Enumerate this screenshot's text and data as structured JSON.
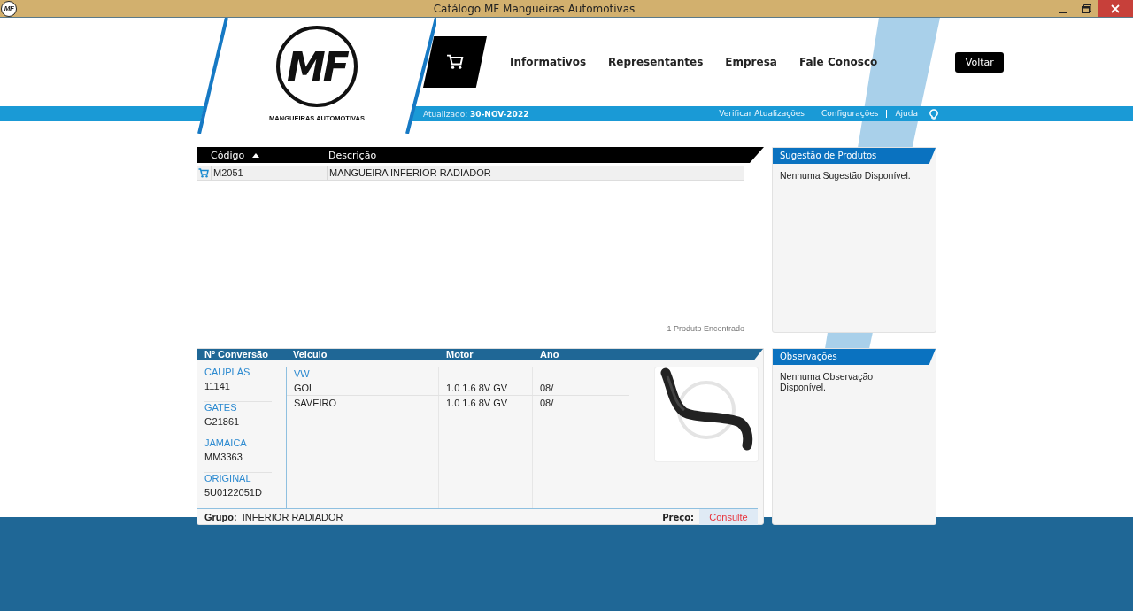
{
  "window": {
    "title": "Catálogo MF Mangueiras Automotivas",
    "icon_label": "MF"
  },
  "header": {
    "logo": {
      "mark": "MF",
      "tagline": "MANGUEIRAS AUTOMOTIVAS"
    },
    "nav": [
      "Informativos",
      "Representantes",
      "Empresa",
      "Fale Conosco"
    ],
    "back_button": "Voltar"
  },
  "info_bar": {
    "updated_label": "Atualizado:",
    "updated_date": "30-NOV-2022",
    "links": [
      "Verificar Atualizações",
      "Configurações",
      "Ajuda"
    ]
  },
  "products": {
    "columns": [
      {
        "label": "Código",
        "sorted_ascending": true
      },
      {
        "label": "Descrição"
      }
    ],
    "rows": [
      {
        "code": "M2051",
        "description": "MANGUEIRA INFERIOR RADIADOR"
      }
    ],
    "count": "1 Produto Encontrado"
  },
  "suggestions": {
    "title": "Sugestão de Produtos",
    "text": "Nenhuma Sugestão Disponível."
  },
  "details": {
    "columns": [
      "Nº Conversão",
      "Veiculo",
      "Motor",
      "Ano"
    ],
    "conversions": [
      {
        "brand": "CAUPLÁS",
        "code": "11141"
      },
      {
        "brand": "GATES",
        "code": "G21861"
      },
      {
        "brand": "JAMAICA",
        "code": "MM3363"
      },
      {
        "brand": "ORIGINAL",
        "code": "5U0122051D"
      }
    ],
    "make": "VW",
    "vehicles": [
      {
        "model": "GOL",
        "motor": "1.0 1.6 8V GV",
        "year": "08/"
      },
      {
        "model": "SAVEIRO",
        "motor": "1.0 1.6 8V GV",
        "year": "08/"
      }
    ],
    "group_label": "Grupo:",
    "group": "INFERIOR RADIADOR",
    "price_label": "Preço:",
    "price": "Consulte"
  },
  "observations": {
    "title": "Observações",
    "text": "Nenhuma Observação Disponível."
  }
}
